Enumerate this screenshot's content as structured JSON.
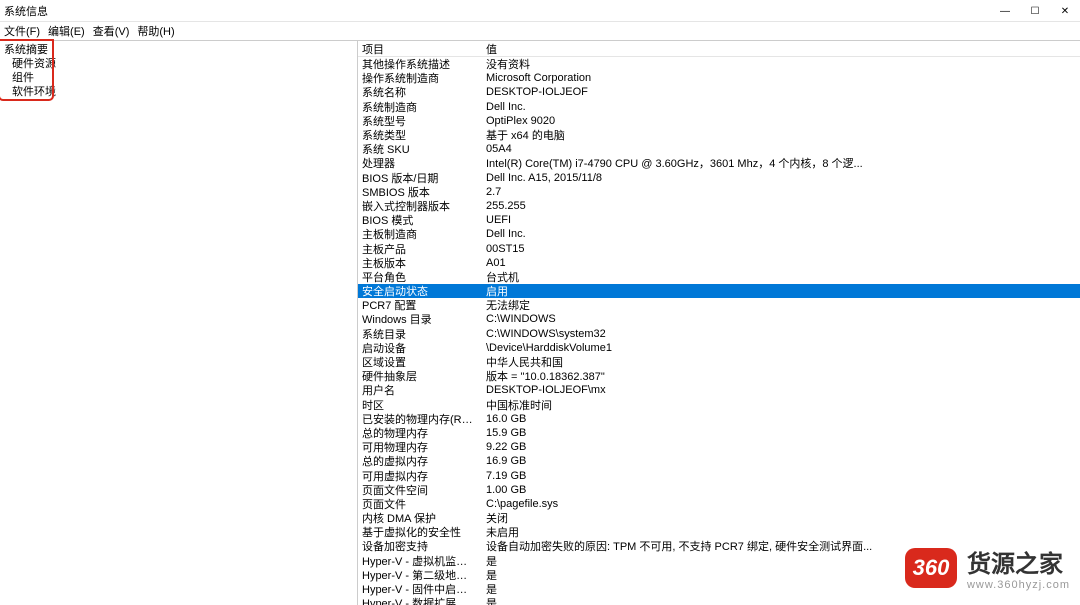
{
  "window": {
    "title": "系统信息",
    "minimize": "—",
    "maximize": "☐",
    "close": "✕"
  },
  "menu": {
    "file": "文件(F)",
    "edit": "编辑(E)",
    "view": "查看(V)",
    "help": "帮助(H)"
  },
  "sidebar": {
    "root": "系统摘要",
    "items": [
      "硬件资源",
      "组件",
      "软件环境"
    ]
  },
  "list": {
    "headers": {
      "key": "项目",
      "value": "值"
    },
    "rows": [
      {
        "k": "其他操作系统描述",
        "v": "没有资料"
      },
      {
        "k": "操作系统制造商",
        "v": "Microsoft Corporation"
      },
      {
        "k": "系统名称",
        "v": "DESKTOP-IOLJEOF"
      },
      {
        "k": "系统制造商",
        "v": "Dell Inc."
      },
      {
        "k": "系统型号",
        "v": "OptiPlex 9020"
      },
      {
        "k": "系统类型",
        "v": "基于 x64 的电脑"
      },
      {
        "k": "系统 SKU",
        "v": "05A4"
      },
      {
        "k": "处理器",
        "v": "Intel(R) Core(TM) i7-4790 CPU @ 3.60GHz，3601 Mhz，4 个内核，8 个逻..."
      },
      {
        "k": "BIOS 版本/日期",
        "v": "Dell Inc. A15, 2015/11/8"
      },
      {
        "k": "SMBIOS 版本",
        "v": "2.7"
      },
      {
        "k": "嵌入式控制器版本",
        "v": "255.255"
      },
      {
        "k": "BIOS 模式",
        "v": "UEFI"
      },
      {
        "k": "主板制造商",
        "v": "Dell Inc."
      },
      {
        "k": "主板产品",
        "v": "00ST15"
      },
      {
        "k": "主板版本",
        "v": "A01"
      },
      {
        "k": "平台角色",
        "v": "台式机"
      },
      {
        "k": "安全启动状态",
        "v": "启用",
        "selected": true
      },
      {
        "k": "PCR7 配置",
        "v": "无法绑定"
      },
      {
        "k": "Windows 目录",
        "v": "C:\\WINDOWS"
      },
      {
        "k": "系统目录",
        "v": "C:\\WINDOWS\\system32"
      },
      {
        "k": "启动设备",
        "v": "\\Device\\HarddiskVolume1"
      },
      {
        "k": "区域设置",
        "v": "中华人民共和国"
      },
      {
        "k": "硬件抽象层",
        "v": "版本 = \"10.0.18362.387\""
      },
      {
        "k": "用户名",
        "v": "DESKTOP-IOLJEOF\\mx"
      },
      {
        "k": "时区",
        "v": "中国标准时间"
      },
      {
        "k": "已安装的物理内存(RAM)",
        "v": "16.0 GB"
      },
      {
        "k": "总的物理内存",
        "v": "15.9 GB"
      },
      {
        "k": "可用物理内存",
        "v": "9.22 GB"
      },
      {
        "k": "总的虚拟内存",
        "v": "16.9 GB"
      },
      {
        "k": "可用虚拟内存",
        "v": "7.19 GB"
      },
      {
        "k": "页面文件空间",
        "v": "1.00 GB"
      },
      {
        "k": "页面文件",
        "v": "C:\\pagefile.sys"
      },
      {
        "k": "内核 DMA 保护",
        "v": "关闭"
      },
      {
        "k": "基于虚拟化的安全性",
        "v": "未启用"
      },
      {
        "k": "设备加密支持",
        "v": "设备自动加密失败的原因: TPM 不可用, 不支持 PCR7 绑定, 硬件安全测试界面..."
      },
      {
        "k": "Hyper-V - 虚拟机监视模式扩展",
        "v": "是"
      },
      {
        "k": "Hyper-V - 第二级地址转换扩展",
        "v": "是"
      },
      {
        "k": "Hyper-V - 固件中启用的虚拟化",
        "v": "是"
      },
      {
        "k": "Hyper-V - 数据扩展保护",
        "v": "是"
      }
    ]
  },
  "watermark": {
    "badge": "360",
    "title": "货源之家",
    "url": "www.360hyzj.com"
  }
}
